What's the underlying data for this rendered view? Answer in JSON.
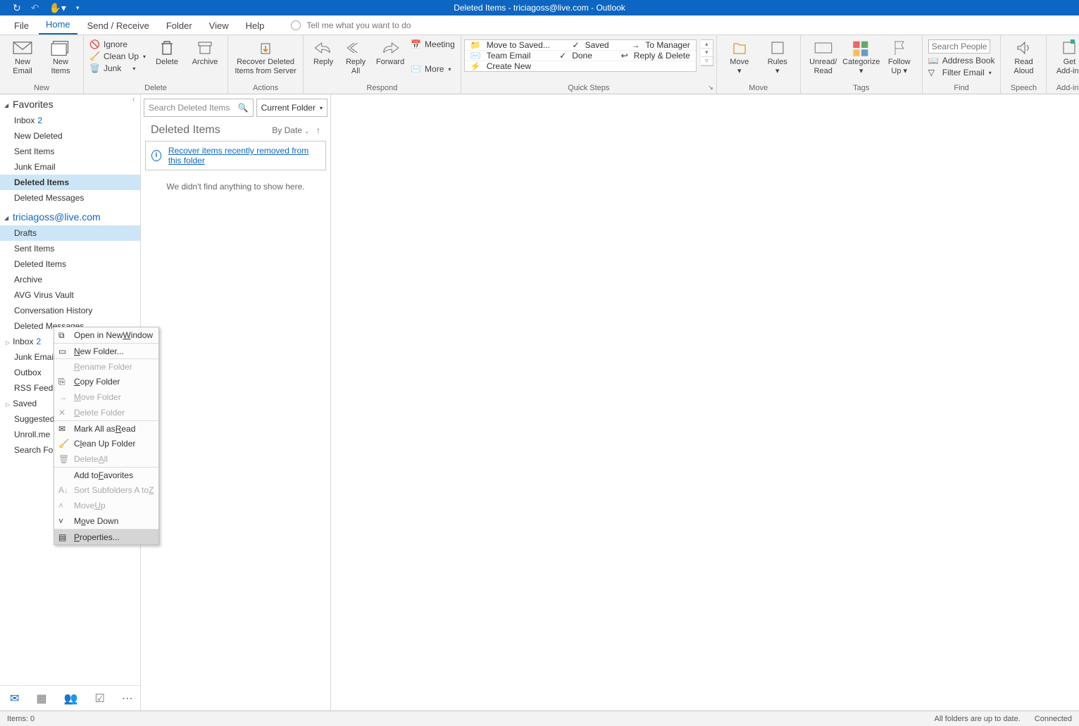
{
  "title": "Deleted Items - triciagoss@live.com  -  Outlook",
  "tabs": [
    "File",
    "Home",
    "Send / Receive",
    "Folder",
    "View",
    "Help"
  ],
  "active_tab": "Home",
  "tellme": "Tell me what you want to do",
  "ribbon": {
    "new": {
      "new_email": "New\nEmail",
      "new_items": "New\nItems",
      "label": "New"
    },
    "delete": {
      "ignore": "Ignore",
      "cleanup": "Clean Up",
      "junk": "Junk",
      "delete": "Delete",
      "archive": "Archive",
      "label": "Delete"
    },
    "actions": {
      "recover": "Recover Deleted\nItems from Server",
      "label": "Actions"
    },
    "respond": {
      "reply": "Reply",
      "reply_all": "Reply\nAll",
      "forward": "Forward",
      "meeting": "Meeting",
      "more": "More",
      "label": "Respond"
    },
    "quicksteps": {
      "items": [
        [
          "Move to Saved...",
          "Saved",
          "To Manager"
        ],
        [
          "Team Email",
          "Done",
          "Reply & Delete"
        ],
        [
          "Create New",
          "",
          ""
        ]
      ],
      "label": "Quick Steps"
    },
    "move": {
      "move": "Move",
      "rules": "Rules",
      "label": "Move"
    },
    "tags": {
      "unread": "Unread/\nRead",
      "categorize": "Categorize",
      "followup": "Follow\nUp",
      "label": "Tags"
    },
    "find": {
      "search_placeholder": "Search People",
      "address_book": "Address Book",
      "filter": "Filter Email",
      "label": "Find"
    },
    "speech": {
      "read": "Read\nAloud",
      "label": "Speech"
    },
    "addins": {
      "get": "Get\nAdd-ins",
      "label": "Add-ins"
    }
  },
  "left": {
    "favorites_hdr": "Favorites",
    "favorites": [
      {
        "label": "Inbox",
        "count": "2"
      },
      {
        "label": "New Deleted"
      },
      {
        "label": "Sent Items"
      },
      {
        "label": "Junk Email"
      },
      {
        "label": "Deleted Items",
        "sel": true
      },
      {
        "label": "Deleted Messages"
      }
    ],
    "account": "triciagoss@live.com",
    "tree": [
      {
        "label": "Drafts",
        "sel2": true
      },
      {
        "label": "Sent Items"
      },
      {
        "label": "Deleted Items"
      },
      {
        "label": "Archive"
      },
      {
        "label": "AVG Virus Vault"
      },
      {
        "label": "Conversation History"
      },
      {
        "label": "Deleted Messages"
      },
      {
        "label": "Inbox",
        "count": "2",
        "arrow": true
      },
      {
        "label": "Junk Email"
      },
      {
        "label": "Outbox"
      },
      {
        "label": "RSS Feeds"
      },
      {
        "label": "Saved",
        "arrow": true
      },
      {
        "label": "Suggested Contacts"
      },
      {
        "label": "Unroll.me"
      },
      {
        "label": "Search Folders"
      }
    ]
  },
  "middle": {
    "search_placeholder": "Search Deleted Items",
    "scope": "Current Folder",
    "header": "Deleted Items",
    "sort": "By Date",
    "recover_link": "Recover items recently removed from this folder",
    "empty": "We didn't find anything to show here."
  },
  "context_menu": [
    {
      "label": "Open in New Window",
      "u": "W",
      "icon": "open"
    },
    {
      "label": "New Folder...",
      "u": "N",
      "icon": "folder",
      "sep": true
    },
    {
      "label": "Rename Folder",
      "u": "R",
      "disabled": true,
      "sep": true
    },
    {
      "label": "Copy Folder",
      "u": "C",
      "icon": "copy"
    },
    {
      "label": "Move Folder",
      "u": "M",
      "disabled": true,
      "icon": "move"
    },
    {
      "label": "Delete Folder",
      "u": "D",
      "disabled": true,
      "icon": "del"
    },
    {
      "label": "Mark All as Read",
      "u": "R",
      "icon": "read",
      "sep": true
    },
    {
      "label": "Clean Up Folder",
      "u": "l",
      "icon": "clean"
    },
    {
      "label": "Delete All",
      "u": "A",
      "disabled": true,
      "icon": "delall"
    },
    {
      "label": "Add to Favorites",
      "u": "F",
      "sep": true
    },
    {
      "label": "Sort Subfolders A to Z",
      "u": "Z",
      "disabled": true,
      "icon": "sort"
    },
    {
      "label": "Move Up",
      "u": "U",
      "disabled": true,
      "icon": "up"
    },
    {
      "label": "Move Down",
      "u": "o",
      "icon": "down"
    },
    {
      "label": "Properties...",
      "u": "P",
      "icon": "props",
      "hover": true,
      "sep": true
    }
  ],
  "status": {
    "left": "Items: 0",
    "right1": "All folders are up to date.",
    "right2": "Connected"
  }
}
